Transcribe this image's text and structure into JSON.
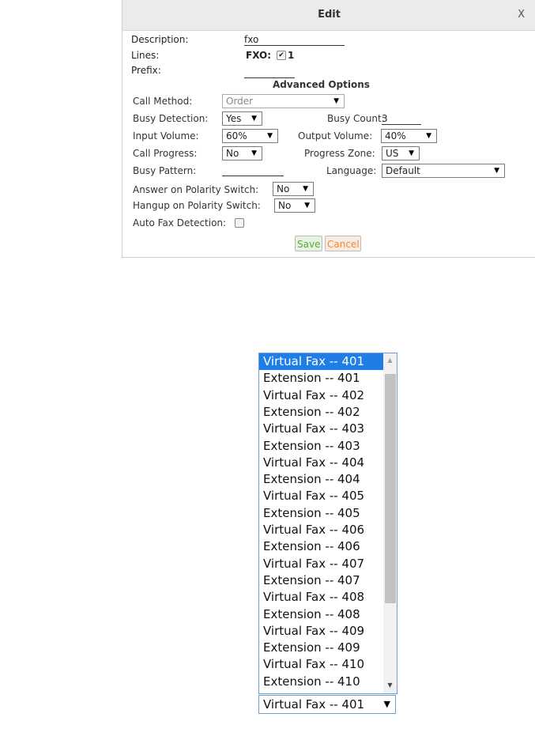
{
  "dialog": {
    "title": "Edit",
    "close_label": "X",
    "description_label": "Description:",
    "description_value": "fxo",
    "lines_label": "Lines:",
    "lines_fxo_label": "FXO:",
    "lines_checkbox_mark": "✔",
    "lines_port": "1",
    "prefix_label": "Prefix:",
    "prefix_value": "",
    "advanced_heading": "Advanced Options",
    "call_method_label": "Call Method:",
    "call_method_value": "Order",
    "busy_detection_label": "Busy Detection:",
    "busy_detection_value": "Yes",
    "busy_count_label": "Busy Count:",
    "busy_count_value": "3",
    "input_volume_label": "Input Volume:",
    "input_volume_value": "60%",
    "output_volume_label": "Output Volume:",
    "output_volume_value": "40%",
    "call_progress_label": "Call Progress:",
    "call_progress_value": "No",
    "progress_zone_label": "Progress Zone:",
    "progress_zone_value": "US",
    "busy_pattern_label": "Busy Pattern:",
    "busy_pattern_value": "",
    "language_label": "Language:",
    "language_value": "Default",
    "answer_polarity_label": "Answer on Polarity Switch:",
    "answer_polarity_value": "No",
    "hangup_polarity_label": "Hangup on Polarity Switch:",
    "hangup_polarity_value": "No",
    "auto_fax_label": "Auto Fax Detection:",
    "save_label": "Save",
    "cancel_label": "Cancel"
  },
  "dropdown": {
    "options": [
      "Virtual Fax -- 401",
      "Extension -- 401",
      "Virtual Fax -- 402",
      "Extension -- 402",
      "Virtual Fax -- 403",
      "Extension -- 403",
      "Virtual Fax -- 404",
      "Extension -- 404",
      "Virtual Fax -- 405",
      "Extension -- 405",
      "Virtual Fax -- 406",
      "Extension -- 406",
      "Virtual Fax -- 407",
      "Extension -- 407",
      "Virtual Fax -- 408",
      "Extension -- 408",
      "Virtual Fax -- 409",
      "Extension -- 409",
      "Virtual Fax -- 410",
      "Extension -- 410"
    ],
    "selected_value": "Virtual Fax -- 401"
  },
  "arrow_glyph": "▼",
  "scroll_up_glyph": "▲",
  "scroll_down_glyph": "▼",
  "colors": {
    "selected_option_bg": "#1e7ee6",
    "save_text": "#5aaa3a",
    "cancel_text": "#f08a3a",
    "dropdown_border": "#6e9fd4"
  }
}
